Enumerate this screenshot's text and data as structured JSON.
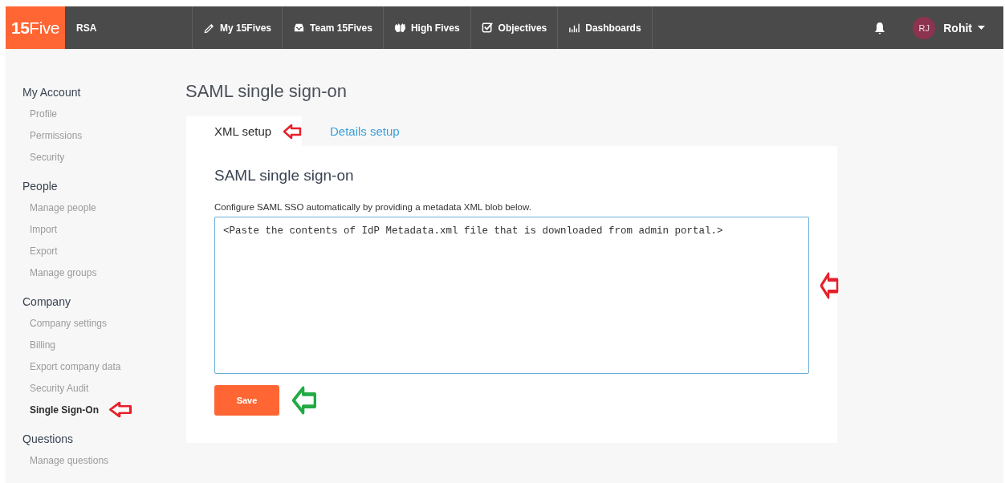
{
  "nav": {
    "logo": "**15**Five",
    "org": "RSA",
    "items": [
      {
        "label": "My 15Fives"
      },
      {
        "label": "Team 15Fives"
      },
      {
        "label": "High Fives"
      },
      {
        "label": "Objectives"
      },
      {
        "label": "Dashboards"
      }
    ],
    "avatar_initials": "RJ",
    "user": "Rohit"
  },
  "sidebar": {
    "sections": [
      {
        "title": "My Account",
        "items": [
          {
            "label": "Profile",
            "selected": false
          },
          {
            "label": "Permissions",
            "selected": false
          },
          {
            "label": "Security",
            "selected": false
          }
        ]
      },
      {
        "title": "People",
        "items": [
          {
            "label": "Manage people",
            "selected": false
          },
          {
            "label": "Import",
            "selected": false
          },
          {
            "label": "Export",
            "selected": false
          },
          {
            "label": "Manage groups",
            "selected": false
          }
        ]
      },
      {
        "title": "Company",
        "items": [
          {
            "label": "Company settings",
            "selected": false
          },
          {
            "label": "Billing",
            "selected": false
          },
          {
            "label": "Export company data",
            "selected": false
          },
          {
            "label": "Security Audit",
            "selected": false
          },
          {
            "label": "Single Sign-On",
            "selected": true
          }
        ]
      },
      {
        "title": "Questions",
        "items": [
          {
            "label": "Manage questions",
            "selected": false
          }
        ]
      }
    ]
  },
  "page_title": "SAML single sign-on",
  "tabs": [
    {
      "label": "XML setup",
      "selected": true
    },
    {
      "label": "Details setup",
      "selected": false
    }
  ],
  "panel": {
    "heading": "SAML single sign-on",
    "description": "Configure SAML SSO automatically by providing a metadata XML blob below.",
    "xml_value": "<Paste the contents of IdP Metadata.xml file that is downloaded from admin portal.>",
    "save_button": "Save"
  }
}
